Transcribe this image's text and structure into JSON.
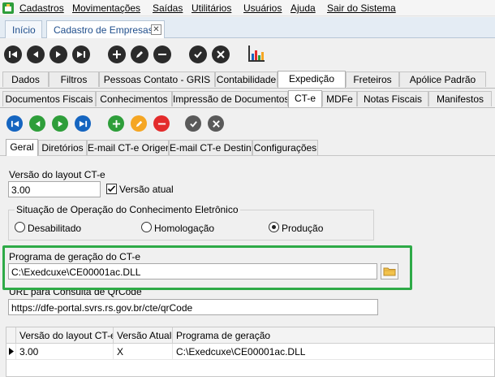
{
  "menu": {
    "items": [
      "Cadastros",
      "Movimentações",
      "Saídas",
      "Utilitários",
      "Usuários",
      "Ajuda",
      "Sair do Sistema"
    ]
  },
  "page_tabs": [
    {
      "label": "Início",
      "active": false
    },
    {
      "label": "Cadastro de Empresas",
      "active": true
    }
  ],
  "main_tabs": [
    "Dados",
    "Filtros",
    "Pessoas Contato - GRIS",
    "Contabilidade",
    "Expedição",
    "Freteiros",
    "Apólice Padrão"
  ],
  "main_tabs_active": "Expedição",
  "exp_tabs": [
    "Documentos Fiscais",
    "Conhecimentos",
    "Impressão de Documentos",
    "CT-e",
    "MDFe",
    "Notas Fiscais",
    "Manifestos"
  ],
  "exp_tabs_active": "CT-e",
  "cte_tabs": [
    "Geral",
    "Diretórios",
    "E-mail CT-e Origem",
    "E-mail CT-e Destino",
    "Configurações"
  ],
  "cte_tabs_active": "Geral",
  "form": {
    "layout_label": "Versão do layout CT-e",
    "layout_value": "3.00",
    "current_version_label": "Versão atual",
    "current_version_checked": true,
    "situacao_label": "Situação de Operação do Conhecimento Eletrônico",
    "radio_options": [
      "Desabilitado",
      "Homologação",
      "Produção"
    ],
    "radio_selected": "Produção",
    "programa_label": "Programa de geração do CT-e",
    "programa_value": "C:\\Exedcuxe\\CE00001ac.DLL",
    "url_label": "URL para Consulta de QrCode",
    "url_value": "https://dfe-portal.svrs.rs.gov.br/cte/qrCode"
  },
  "grid": {
    "columns": [
      "Versão do layout CT-e",
      "Versão Atual",
      "Programa de geração"
    ],
    "rows": [
      [
        "3.00",
        "X",
        "C:\\Exedcuxe\\CE00001ac.DLL"
      ]
    ]
  },
  "colors": {
    "nav_dark": "#2b2b2b",
    "nav_blue": "#1565c0",
    "nav_green": "#2e9e3a",
    "add_green": "#2e9e3a",
    "edit_orange": "#f5a623",
    "delete_red": "#e32b2b",
    "confirm_gray": "#5a5a5a",
    "highlight_green": "#2eaa47",
    "tab_text_blue": "#1f4e8c"
  },
  "icons": {
    "app": "app-logo-icon",
    "toolbar": [
      "first-icon",
      "previous-icon",
      "next-icon",
      "last-icon",
      "add-icon",
      "edit-icon",
      "remove-icon",
      "confirm-icon",
      "cancel-icon",
      "report-chart-icon"
    ],
    "folder": "folder-icon",
    "row_indicator": "row-pointer-icon"
  }
}
